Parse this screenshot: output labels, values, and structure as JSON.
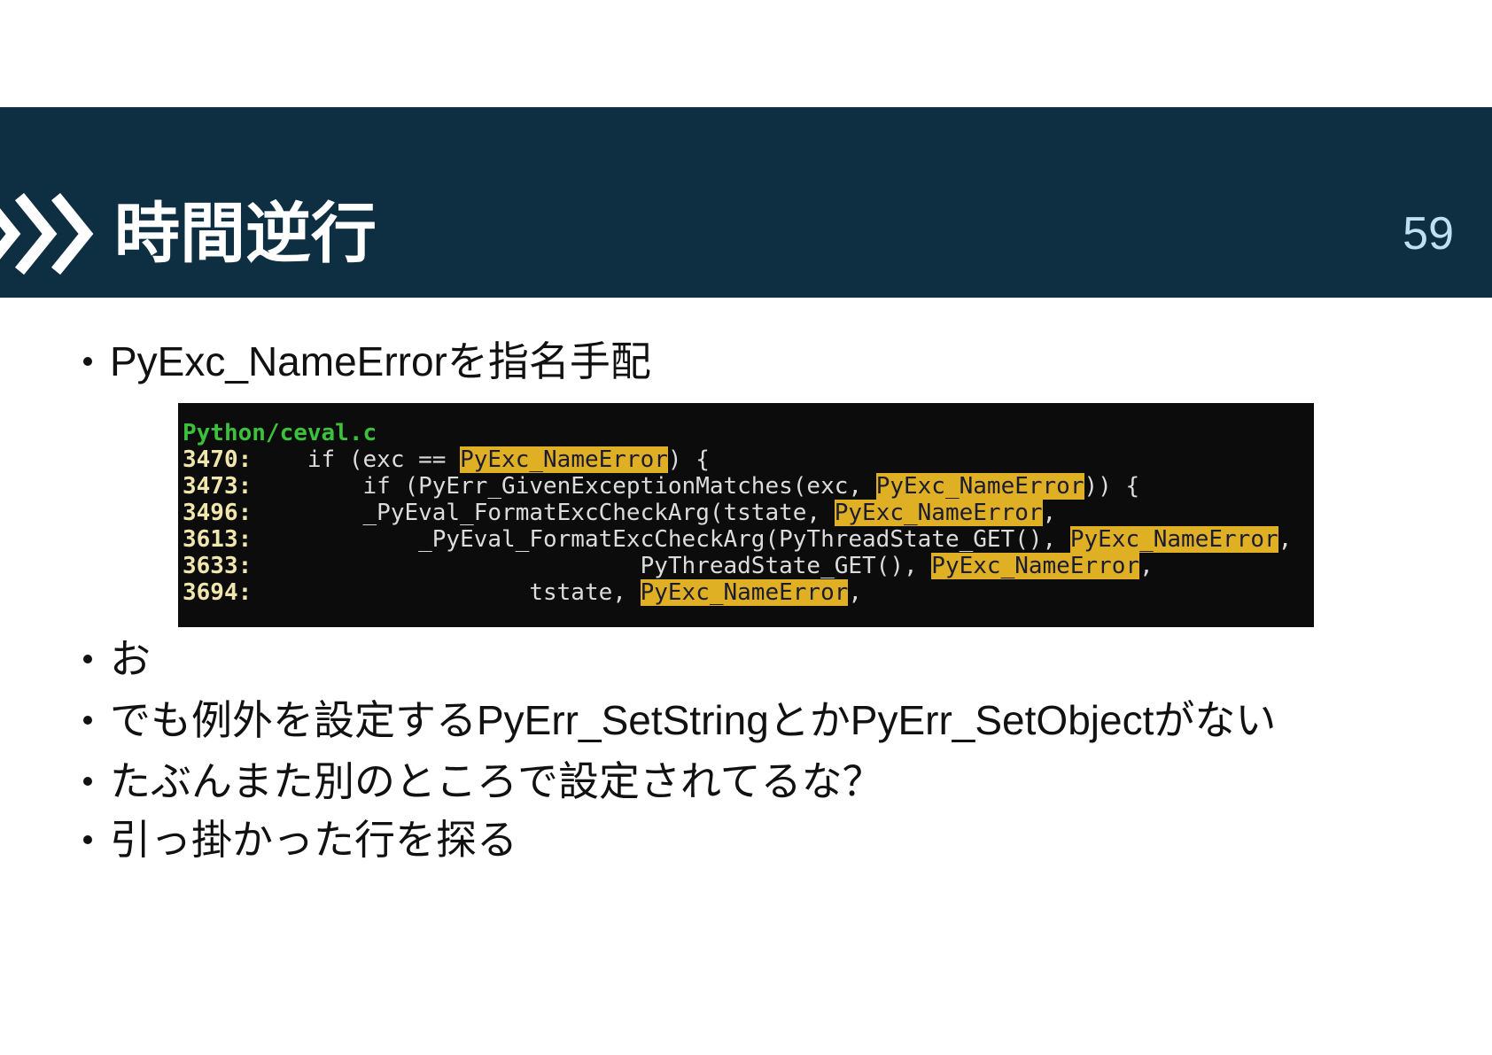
{
  "colors": {
    "header_bg": "#0e2f42",
    "title": "#ffffff",
    "page_number": "#bfe0f2",
    "text": "#111111",
    "code_bg": "#0c0c0c",
    "code_text": "#dcdcdc",
    "line_number": "#f1e7ad",
    "file_path": "#3cc13c",
    "highlight": "#e0b024",
    "highlight_text": "#1b1b33"
  },
  "header": {
    "icon": "triple-chevron-icon",
    "title": "時間逆行",
    "page_number": "59"
  },
  "bullets": [
    "PyExc_NameErrorを指名手配",
    "お",
    "でも例外を設定するPyErr_SetStringとかPyErr_SetObjectがない",
    "たぶんまた別のところで設定されてるな？",
    "引っ掛かった行を探る"
  ],
  "code": {
    "file": "Python/ceval.c",
    "lines": [
      {
        "num": "3470:",
        "before": "    if (exc == ",
        "match": "PyExc_NameError",
        "after": ") {"
      },
      {
        "num": "3473:",
        "before": "        if (PyErr_GivenExceptionMatches(exc, ",
        "match": "PyExc_NameError",
        "after": ")) {"
      },
      {
        "num": "3496:",
        "before": "        _PyEval_FormatExcCheckArg(tstate, ",
        "match": "PyExc_NameError",
        "after": ","
      },
      {
        "num": "3613:",
        "before": "            _PyEval_FormatExcCheckArg(PyThreadState_GET(), ",
        "match": "PyExc_NameError",
        "after": ","
      },
      {
        "num": "3633:",
        "before": "                            PyThreadState_GET(), ",
        "match": "PyExc_NameError",
        "after": ","
      },
      {
        "num": "3694:",
        "before": "                    tstate, ",
        "match": "PyExc_NameError",
        "after": ","
      }
    ]
  }
}
